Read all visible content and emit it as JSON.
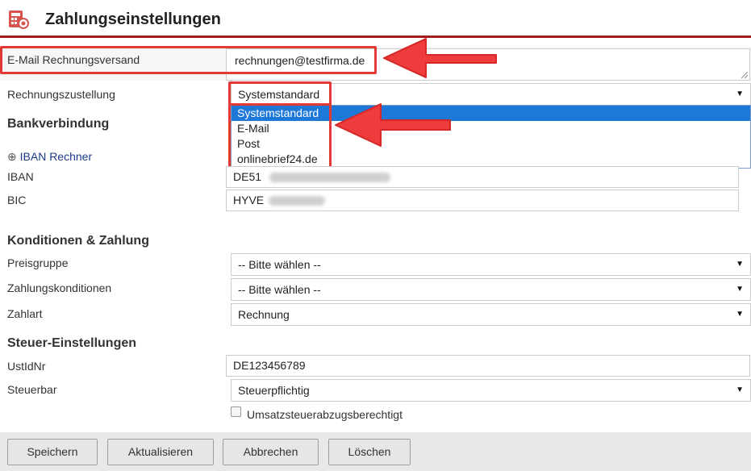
{
  "header": {
    "title": "Zahlungseinstellungen",
    "icon": "calculator-icon"
  },
  "invoice_email": {
    "label": "E-Mail Rechnungsversand",
    "value": "rechnungen@testfirma.de"
  },
  "delivery": {
    "label": "Rechnungszustellung",
    "selected": "Systemstandard",
    "options": [
      "Systemstandard",
      "E-Mail",
      "Post",
      "onlinebrief24.de"
    ]
  },
  "bank": {
    "heading": "Bankverbindung",
    "iban_calc_link": "IBAN Rechner",
    "iban_label": "IBAN",
    "iban_value": "DE51",
    "bic_label": "BIC",
    "bic_value": "HYVE"
  },
  "conditions": {
    "heading": "Konditionen & Zahlung",
    "price_group_label": "Preisgruppe",
    "price_group_value": "-- Bitte wählen --",
    "payment_terms_label": "Zahlungskonditionen",
    "payment_terms_value": "-- Bitte wählen --",
    "payment_type_label": "Zahlart",
    "payment_type_value": "Rechnung"
  },
  "tax": {
    "heading": "Steuer-Einstellungen",
    "vat_id_label": "UstIdNr",
    "vat_id_value": "DE123456789",
    "taxable_label": "Steuerbar",
    "taxable_value": "Steuerpflichtig",
    "reverse_charge_label": "Umsatzsteuerabzugsberechtigt"
  },
  "buttons": {
    "save": "Speichern",
    "refresh": "Aktualisieren",
    "cancel": "Abbrechen",
    "delete": "Löschen"
  },
  "colors": {
    "accent_bar": "#a11d1d",
    "annotation_red": "#e53935",
    "selection_blue": "#1e78d8"
  }
}
